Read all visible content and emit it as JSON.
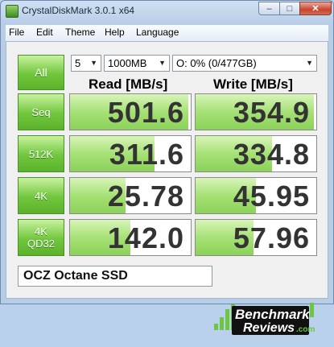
{
  "window": {
    "title": "CrystalDiskMark 3.0.1 x64",
    "buttons": {
      "minimize": "–",
      "maximize": "□",
      "close": "✕"
    }
  },
  "menu": [
    "File",
    "Edit",
    "Theme",
    "Help",
    "Language"
  ],
  "controls": {
    "all_label": "All",
    "runs": "5",
    "size": "1000MB",
    "drive": "O: 0% (0/477GB)"
  },
  "headers": {
    "read": "Read [MB/s]",
    "write": "Write [MB/s]"
  },
  "rows": [
    {
      "label": [
        "Seq"
      ],
      "read": "501.6",
      "write": "354.9",
      "read_fill": 0.98,
      "write_fill": 0.98
    },
    {
      "label": [
        "512K"
      ],
      "read": "311.6",
      "write": "334.8",
      "read_fill": 0.7,
      "write_fill": 0.63
    },
    {
      "label": [
        "4K"
      ],
      "read": "25.78",
      "write": "45.95",
      "read_fill": 0.46,
      "write_fill": 0.5
    },
    {
      "label": [
        "4K",
        "QD32"
      ],
      "read": "142.0",
      "write": "57.96",
      "read_fill": 0.5,
      "write_fill": 0.48
    }
  ],
  "comment": "OCZ Octane SSD",
  "watermark": {
    "line1": "Benchmark",
    "line2": "Reviews",
    "suffix": ".com"
  },
  "colors": {
    "accent_green": "#70c63c",
    "bar_green": "#a6e176",
    "title_bg": "#b9d1ea"
  }
}
